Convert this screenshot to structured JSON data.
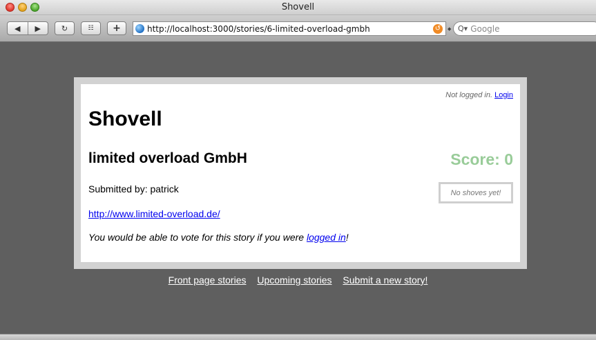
{
  "window": {
    "title": "Shovell"
  },
  "toolbar": {
    "back_icon": "back-arrow-icon",
    "forward_icon": "forward-arrow-icon",
    "reload_icon": "reload-icon",
    "add_bookmark_label": "+",
    "address_value": "http://localhost:3000/stories/6-limited-overload-gmbh",
    "search_placeholder": "Google"
  },
  "page": {
    "login_status": "Not logged in.",
    "login_link": "Login",
    "site_title": "Shovell",
    "story_title": "limited overload GmbH",
    "score_label": "Score: 0",
    "submitted_by": "Submitted by: patrick",
    "shove_status": "No shoves yet!",
    "story_url": "http://www.limited-overload.de/",
    "vote_text_before": "You would be able to vote for this story if you were ",
    "vote_link": "logged in",
    "vote_text_after": "!"
  },
  "footer": {
    "links": [
      "Front page stories",
      "Upcoming stories",
      "Submit a new story!"
    ]
  },
  "colors": {
    "score": "#99cc99",
    "background": "#5f5f5f",
    "link": "#0000ee"
  }
}
